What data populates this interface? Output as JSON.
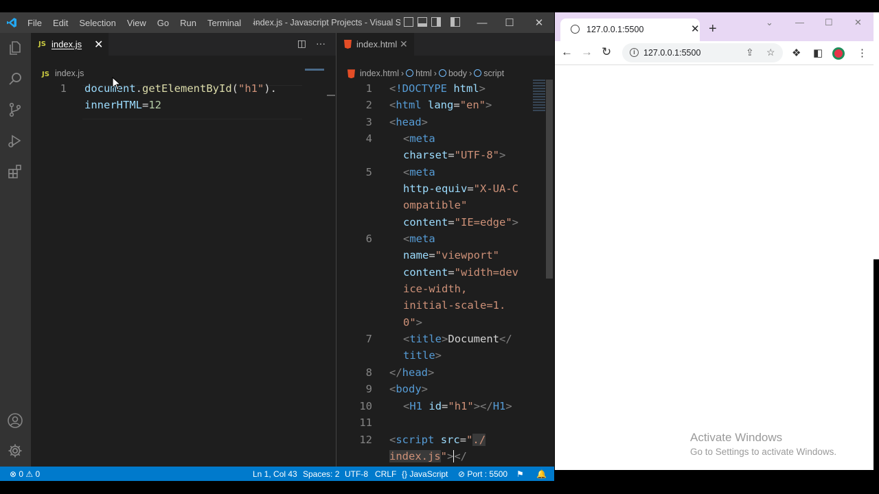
{
  "vscode": {
    "menu": [
      "File",
      "Edit",
      "Selection",
      "View",
      "Go",
      "Run",
      "Terminal"
    ],
    "menu_more": "···",
    "window_title": "index.js - Javascript Projects - Visual Studi...",
    "left_editor": {
      "tab_badge": "JS",
      "tab_label": "index.js",
      "tab_close": "✕",
      "breadcrumb": "index.js",
      "line_numbers": [
        "1"
      ],
      "code": {
        "l1a": "document",
        "l1b": ".",
        "l1c": "getElementById",
        "l1d": "(",
        "l1e": "\"h1\"",
        "l1f": ").",
        "l2a": "innerHTML",
        "l2b": "=",
        "l2c": "12"
      }
    },
    "right_editor": {
      "tab_label": "index.html",
      "tab_close": "✕",
      "breadcrumb": [
        "index.html",
        "html",
        "body",
        "script"
      ],
      "line_numbers": [
        "1",
        "2",
        "3",
        "4",
        "5",
        "6",
        "7",
        "8",
        "9",
        "10",
        "11",
        "12"
      ]
    },
    "status": {
      "problems": "⊗ 0 ⚠ 0",
      "position": "Ln 1, Col 43",
      "spaces": "Spaces: 2",
      "encoding": "UTF-8",
      "eol": "CRLF",
      "language": "{} JavaScript",
      "port": "⊘ Port : 5500"
    }
  },
  "browser": {
    "tab_title": "127.0.0.1:5500",
    "tab_close": "✕",
    "new_tab": "+",
    "url": "127.0.0.1:5500"
  },
  "watermark": {
    "line1": "Activate Windows",
    "line2": "Go to Settings to activate Windows."
  },
  "colors": {
    "accent": "#007acc",
    "titlebar": "#3c3c3c",
    "editor_bg": "#1e1e1e",
    "browser_tabstrip": "#e8d8f4"
  }
}
